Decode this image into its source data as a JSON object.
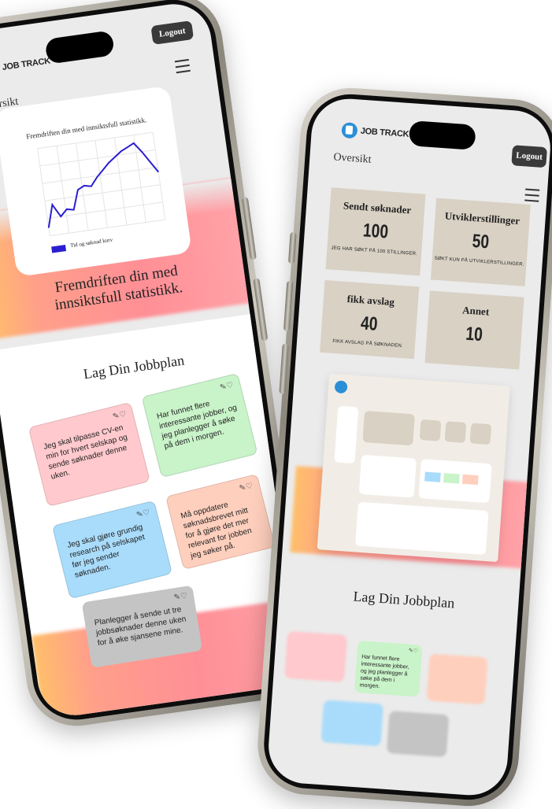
{
  "app": {
    "name": "JOB TRACK",
    "logout_label": "Logout",
    "overview_label": "Oversikt"
  },
  "left_phone": {
    "chart": {
      "title": "Fremdriften din med innsiktsfull statistikk.",
      "legend": "Tid og søknad kurv"
    },
    "headline": "Fremdriften din med innsiktsfull statistikk.",
    "plan_title": "Lag Din Jobbplan",
    "notes": [
      {
        "text": "Jeg skal tilpasse CV-en min for hvert selskap og sende søknader denne uken.",
        "color": "#ffc9cd"
      },
      {
        "text": "Har funnet flere interessante jobber, og jeg planlegger å søke på dem i morgen.",
        "color": "#c9f3c9"
      },
      {
        "text": "Jeg skal gjøre grundig research på selskapet før jeg sender søknaden.",
        "color": "#a9dcfb"
      },
      {
        "text": "Må oppdatere søknadsbrevet mitt for å gjøre det mer relevant for jobben jeg søker på.",
        "color": "#ffcfbd"
      },
      {
        "text": "Planlegger å sende ut tre jobbsøknader denne uken for å øke sjansene mine.",
        "color": "#c4c4c4"
      }
    ],
    "note_icons": "✎♡"
  },
  "right_phone": {
    "stats": [
      {
        "title": "Sendt søknader",
        "value": "100",
        "sub": "JEG HAR SØKT PÅ 100 STILLINGER."
      },
      {
        "title": "Utviklerstillinger",
        "value": "50",
        "sub": "SØKT KUN PÅ UTVIKLERSTILLINGER."
      },
      {
        "title": "fikk avslag",
        "value": "40",
        "sub": "FIKK AVSLAG PÅ SØKNADEN."
      },
      {
        "title": "Annet",
        "value": "10",
        "sub": ""
      }
    ],
    "plan_title": "Lag Din Jobbplan",
    "visible_note": "Har funnet flere interessante jobber, og jeg planlegger å søke på dem i morgen."
  },
  "chart_data": {
    "type": "line",
    "title": "Fremdriften din med innsiktsfull statistikk.",
    "series": [
      {
        "name": "Tid og søknad kurv",
        "color": "#2a1fd0",
        "values": [
          10,
          38,
          22,
          30,
          28,
          52,
          56,
          54,
          64,
          72,
          80,
          86,
          92,
          96,
          100,
          88,
          74,
          60
        ]
      }
    ]
  },
  "colors": {
    "line": "#2a1fd0",
    "stat_bg": "#d8d1c4",
    "logout_bg": "#3a3a3a"
  }
}
